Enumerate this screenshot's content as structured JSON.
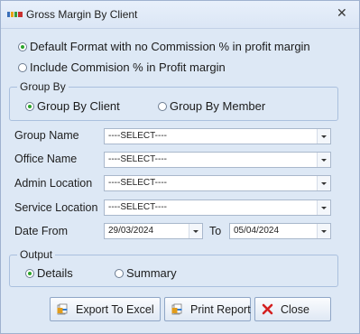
{
  "window": {
    "title": "Gross Margin By Client",
    "close_glyph": "✕"
  },
  "format_options": [
    {
      "label": "Default Format with no Commission % in profit margin",
      "checked": true
    },
    {
      "label": "Include Commision % in Profit margin",
      "checked": false
    }
  ],
  "group_by": {
    "legend": "Group By",
    "options": [
      {
        "label": "Group By Client",
        "checked": true
      },
      {
        "label": "Group By Member",
        "checked": false
      }
    ]
  },
  "fields": {
    "group_name": {
      "label": "Group Name",
      "value": "----SELECT----"
    },
    "office_name": {
      "label": "Office Name",
      "value": "----SELECT----"
    },
    "admin_location": {
      "label": "Admin Location",
      "value": "----SELECT----"
    },
    "service_location": {
      "label": "Service Location",
      "value": "----SELECT----"
    }
  },
  "date_range": {
    "from_label": "Date From",
    "from_value": "29/03/2024",
    "to_label": "To",
    "to_value": "05/04/2024"
  },
  "output": {
    "legend": "Output",
    "options": [
      {
        "label": "Details",
        "checked": true
      },
      {
        "label": "Summary",
        "checked": false
      }
    ]
  },
  "buttons": {
    "export_label": "Export To Excel",
    "print_label": "Print Report",
    "close_label": "Close"
  },
  "icons": {
    "app": "app-logo-icon",
    "export": "excel-export-icon",
    "print": "print-report-icon",
    "close": "red-x-close-icon"
  },
  "colors": {
    "background": "#dde8f5",
    "radio_checked": "#2aa52a",
    "close_icon": "#d42020"
  }
}
